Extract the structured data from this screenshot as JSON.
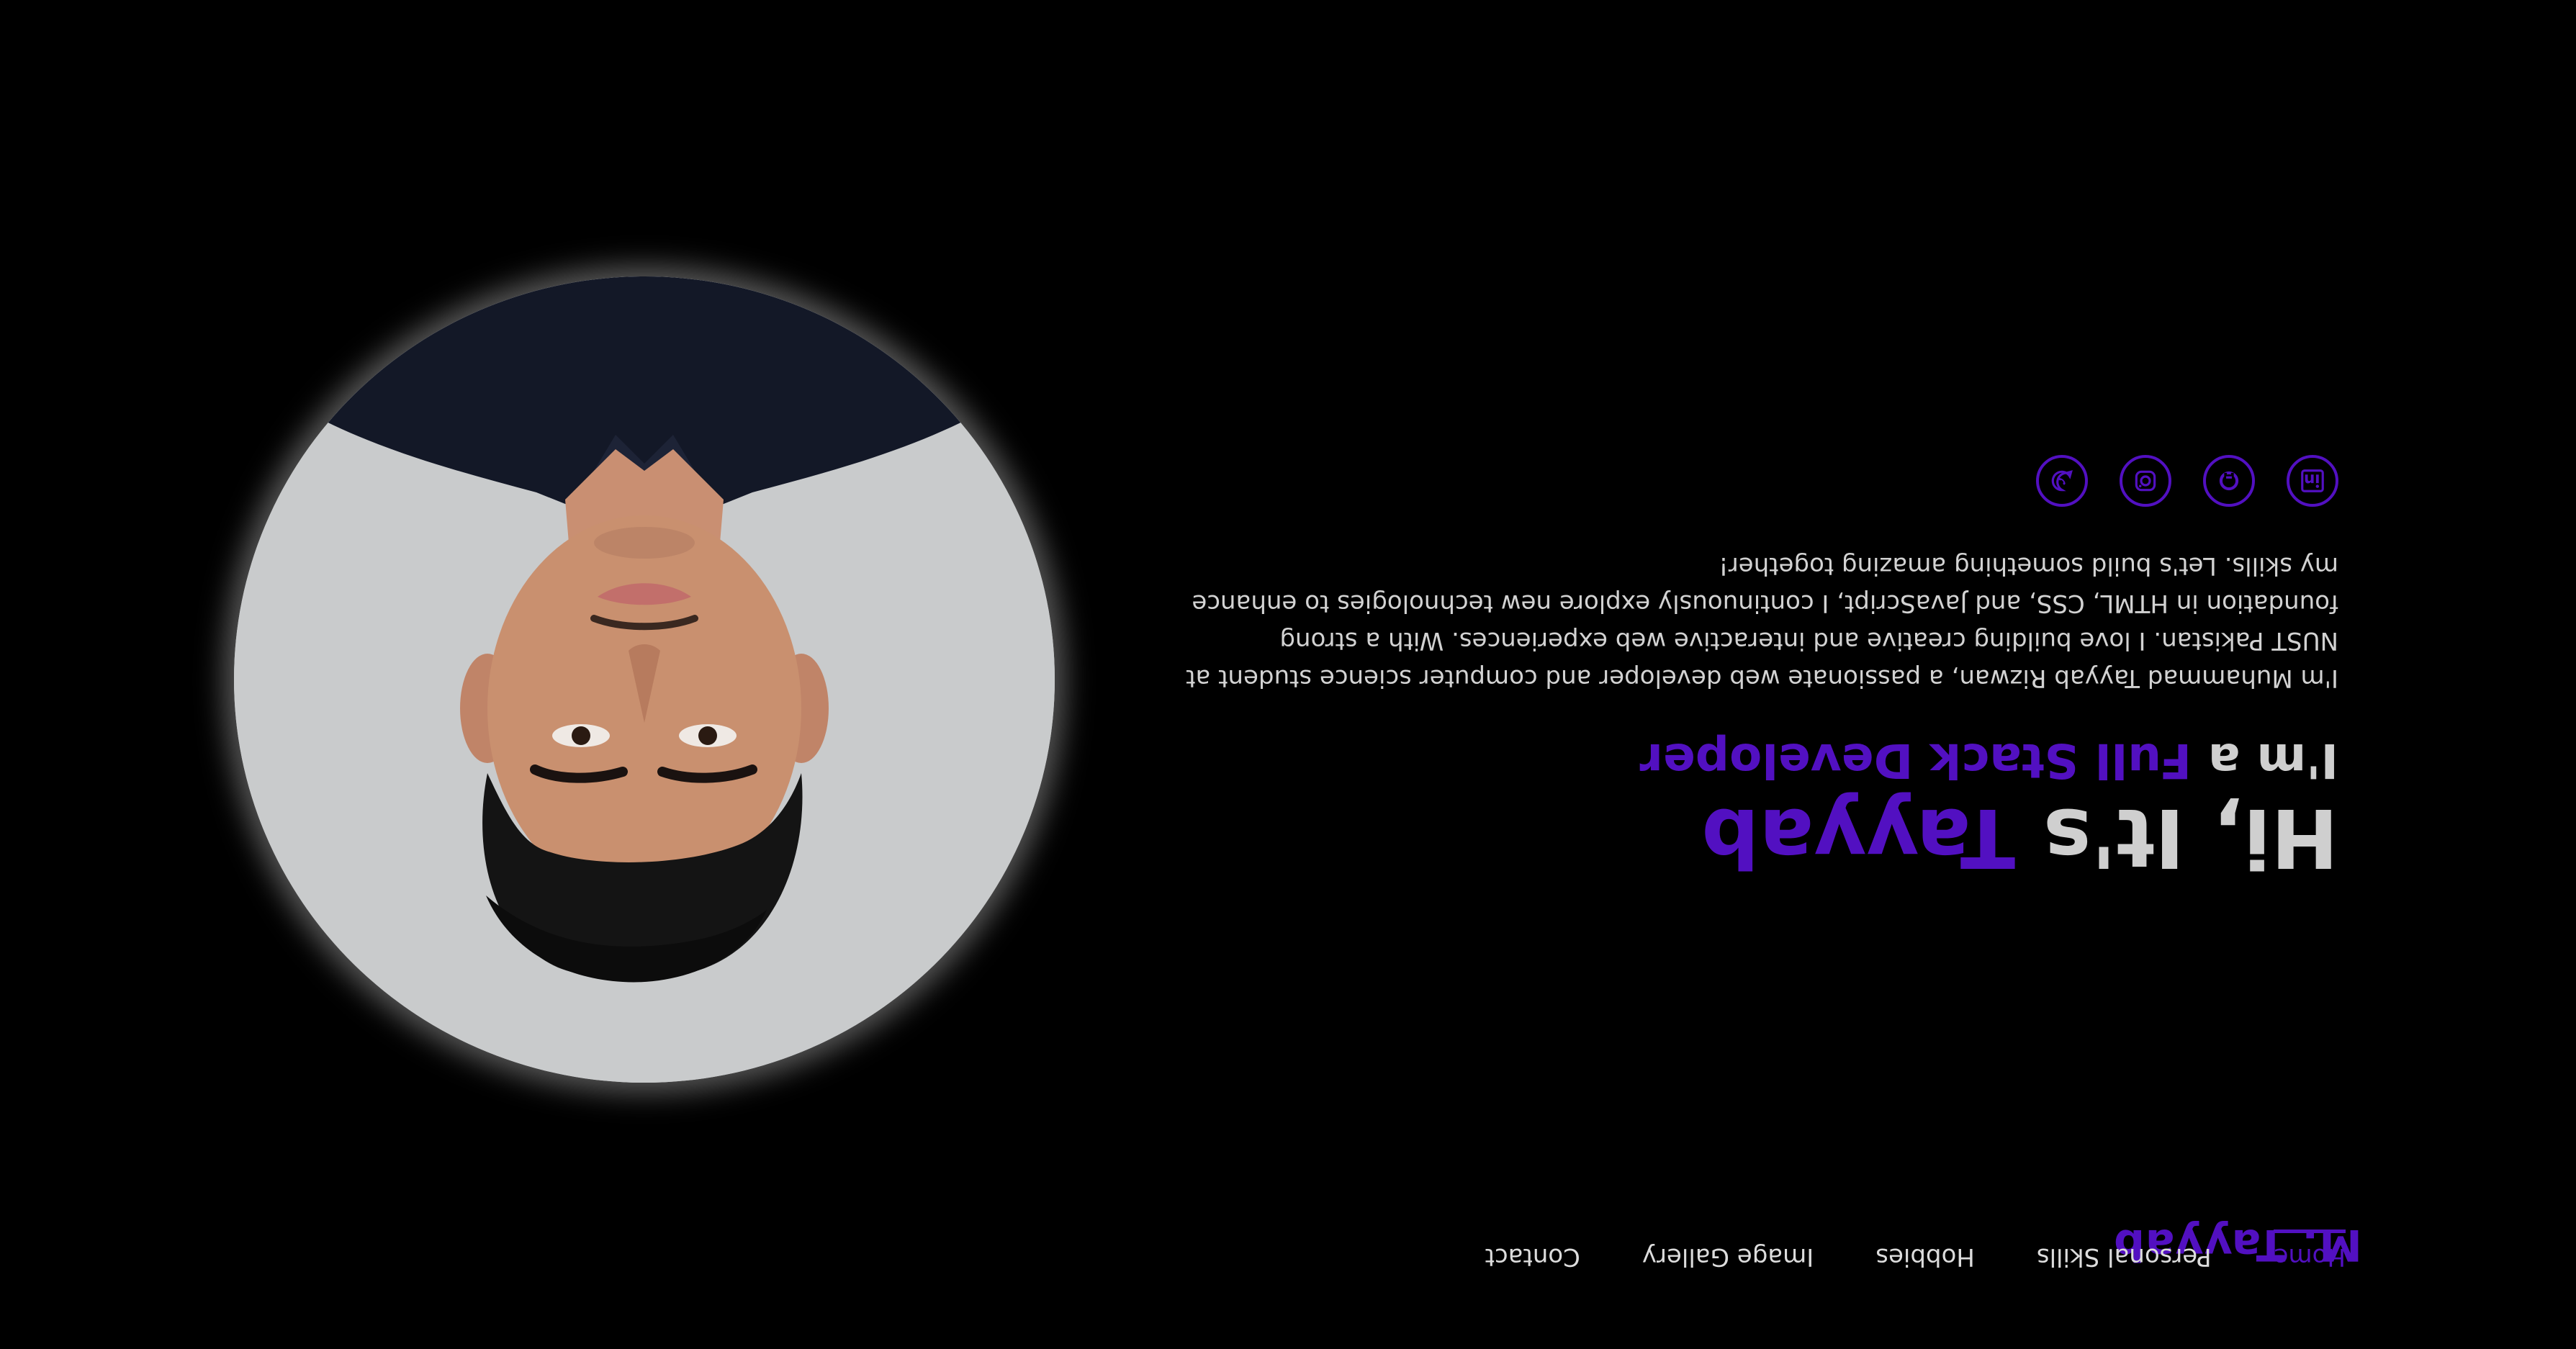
{
  "navbar": {
    "logo": "M. Tayyab",
    "links": [
      {
        "label": "Home",
        "active": true
      },
      {
        "label": "Personal Skills",
        "active": false
      },
      {
        "label": "Hobbies",
        "active": false
      },
      {
        "label": "Image Gallery",
        "active": false
      },
      {
        "label": "Contact",
        "active": false
      }
    ]
  },
  "hero": {
    "greeting_prefix": "Hi, It's",
    "name": "Tayyab",
    "role_prefix": "I'm a",
    "role": "Full Stack Developer",
    "about": "I'm Muhammad Tayyab Rizwan, a passionate web developer and computer science student at NUST Pakistan. I love building creative and interactive web experiences. With a strong foundation in HTML, CSS, and JavaScript, I continuously explore new technologies to enhance my skills. Let's build something amazing together!",
    "socials": [
      {
        "icon": "linkedin-icon"
      },
      {
        "icon": "github-icon"
      },
      {
        "icon": "instagram-icon"
      },
      {
        "icon": "whatsapp-icon"
      }
    ]
  },
  "profile_image": {
    "icon": "profile-photo"
  },
  "colors": {
    "accent": "#5210c1",
    "background": "#000000",
    "text": "#d2d2d2"
  }
}
